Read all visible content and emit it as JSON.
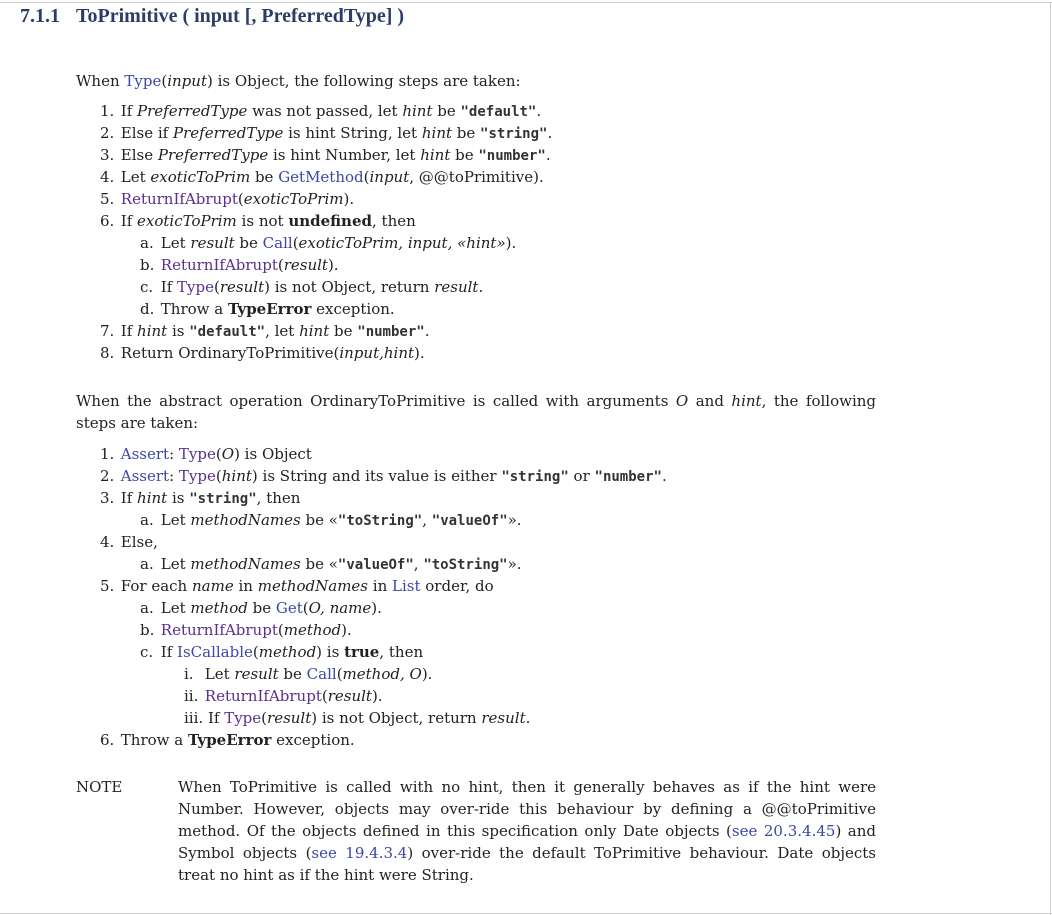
{
  "heading": {
    "number": "7.1.1",
    "title": "ToPrimitive ( input [, PreferredType] )"
  },
  "intro1": {
    "t1": "When ",
    "type": "Type",
    "t2": "(",
    "input": "input",
    "t3": ") is Object, the following steps are taken:"
  },
  "steps1": [
    {
      "mk": "1.",
      "a": "If ",
      "b": "PreferredType",
      "c": " was not passed, let ",
      "d": "hint",
      "e": " be ",
      "code": "\"default\"",
      "f": "."
    },
    {
      "mk": "2.",
      "a": "Else if ",
      "b": "PreferredType",
      "c": " is hint String, let ",
      "d": "hint",
      "e": " be ",
      "code": "\"string\"",
      "f": "."
    },
    {
      "mk": "3.",
      "a": "Else ",
      "b": "PreferredType",
      "c": " is hint Number, let ",
      "d": "hint",
      "e": " be ",
      "code": "\"number\"",
      "f": "."
    }
  ],
  "step4": {
    "mk": "4.",
    "a": "Let ",
    "b": "exoticToPrim",
    "c": " be ",
    "link": "GetMethod",
    "d": "(",
    "e": "input",
    "f": ", @@toPrimitive)."
  },
  "step5": {
    "mk": "5.",
    "link": "ReturnIfAbrupt",
    "a": "(",
    "b": "exoticToPrim",
    "c": ")."
  },
  "step6": {
    "mk": "6.",
    "a": "If ",
    "b": "exoticToPrim",
    "c": " is not ",
    "d": "undefined",
    "e": ", then"
  },
  "step6a": {
    "mk": "a.",
    "a": "Let ",
    "b": "result",
    "c": " be ",
    "link": "Call",
    "d": "(",
    "e": "exoticToPrim, input, «hint»",
    "f": ")."
  },
  "step6b": {
    "mk": "b.",
    "link": "ReturnIfAbrupt",
    "a": "(",
    "b": "result",
    "c": ")."
  },
  "step6c": {
    "mk": "c.",
    "a": "If ",
    "link": "Type",
    "b": "(",
    "c": "result",
    "d": ") is not Object, return ",
    "e": "result",
    "f": "."
  },
  "step6d": {
    "mk": "d.",
    "a": "Throw a ",
    "b": "TypeError",
    "c": " exception."
  },
  "step7": {
    "mk": "7.",
    "a": "If ",
    "b": "hint",
    "c": " is ",
    "code": "\"default\"",
    "d": ", let ",
    "e": "hint",
    "f": " be ",
    "code2": "\"number\"",
    "g": "."
  },
  "step8": {
    "mk": "8.",
    "a": "Return OrdinaryToPrimitive(",
    "b": "input,hint",
    "c": ")."
  },
  "intro2": {
    "a": "When the abstract operation OrdinaryToPrimitive is called with arguments ",
    "o": "O",
    "b": " and ",
    "hint": "hint",
    "c": ", the following steps are taken:"
  },
  "s2_1": {
    "mk": "1.",
    "link": "Assert",
    "a": ": ",
    "link2": "Type",
    "b": "(",
    "c": "O",
    "d": ") is Object"
  },
  "s2_2": {
    "mk": "2.",
    "link": "Assert",
    "a": ": ",
    "link2": "Type",
    "b": "(",
    "c": "hint",
    "d": ") is String and its value is either ",
    "code": "\"string\"",
    "e": " or ",
    "code2": "\"number\"",
    "f": "."
  },
  "s2_3": {
    "mk": "3.",
    "a": "If ",
    "b": "hint",
    "c": " is ",
    "code": "\"string\"",
    "d": ", then"
  },
  "s2_3a": {
    "mk": "a.",
    "a": "Let ",
    "b": "methodNames",
    "c": " be «",
    "code": "\"toString\"",
    "d": ", ",
    "code2": "\"valueOf\"",
    "e": "»."
  },
  "s2_4": {
    "mk": "4.",
    "a": "Else,"
  },
  "s2_4a": {
    "mk": "a.",
    "a": "Let ",
    "b": "methodNames",
    "c": " be «",
    "code": "\"valueOf\"",
    "d": ", ",
    "code2": "\"toString\"",
    "e": "»."
  },
  "s2_5": {
    "mk": "5.",
    "a": "For each ",
    "b": "name",
    "c": " in ",
    "d": "methodNames",
    "e": " in ",
    "link": "List",
    "f": " order, do"
  },
  "s2_5a": {
    "mk": "a.",
    "a": "Let ",
    "b": "method",
    "c": " be ",
    "link": "Get",
    "d": "(",
    "e": "O, name",
    "f": ")."
  },
  "s2_5b": {
    "mk": "b.",
    "link": "ReturnIfAbrupt",
    "a": "(",
    "b": "method",
    "c": ")."
  },
  "s2_5c": {
    "mk": "c.",
    "a": "If ",
    "link": "IsCallable",
    "b": "(",
    "c": "method",
    "d": ") is ",
    "e": "true",
    "f": ", then"
  },
  "s2_5ci": {
    "mk": "i.",
    "a": "Let ",
    "b": "result",
    "c": " be ",
    "link": "Call",
    "d": "(",
    "e": "method, O",
    "f": ")."
  },
  "s2_5cii": {
    "mk": "ii.",
    "link": "ReturnIfAbrupt",
    "a": "(",
    "b": "result",
    "c": ")."
  },
  "s2_5ciii": {
    "mk": "iii.",
    "a": "If ",
    "link": "Type",
    "b": "(",
    "c": "result",
    "d": ") is not Object, return ",
    "e": "result",
    "f": "."
  },
  "s2_6": {
    "mk": "6.",
    "a": "Throw a ",
    "b": "TypeError",
    "c": " exception."
  },
  "note": {
    "label": "NOTE",
    "a": "When ToPrimitive is called with no hint, then it generally behaves as if the hint were Number. However, objects may over-ride this behaviour by defining a @@toPrimitive method. Of the objects defined in this specification only Date objects (",
    "link1": "see 20.3.4.45",
    "b": ") and Symbol objects (",
    "link2": "see 19.4.3.4",
    "c": ") over-ride the default ToPrimitive behaviour. Date objects treat no hint as if the hint were String."
  },
  "colors": {
    "heading": "#2b3c66",
    "link": "#3a47a6",
    "visited": "#5a2f8f"
  }
}
